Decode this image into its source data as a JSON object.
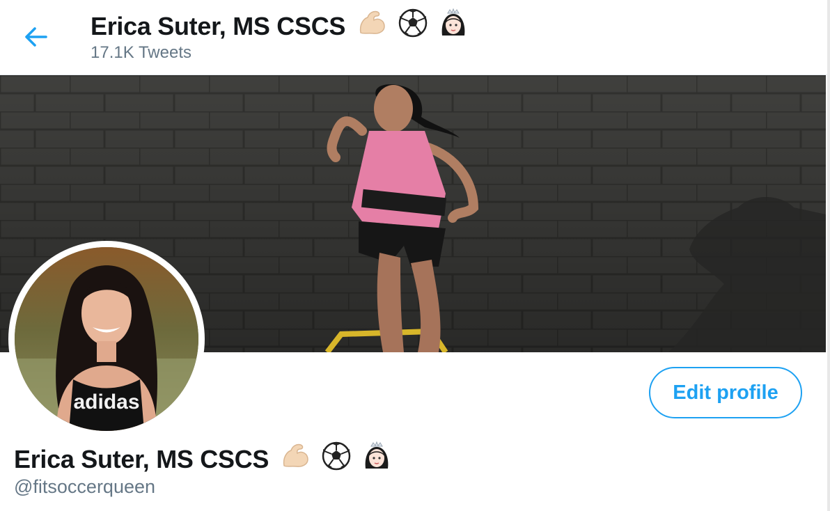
{
  "header": {
    "back_label": "Back",
    "title": "Erica Suter, MS CSCS",
    "tweet_count": "17.1K Tweets"
  },
  "profile": {
    "name": "Erica Suter, MS CSCS",
    "handle": "@fitsoccerqueen",
    "name_emojis": [
      "flexed-biceps-icon",
      "soccer-ball-icon",
      "princess-icon"
    ],
    "edit_button_label": "Edit profile",
    "avatar_shirt_text": "adidas"
  },
  "colors": {
    "accent": "#1da1f2",
    "text_primary": "#14171a",
    "text_secondary": "#657786"
  }
}
